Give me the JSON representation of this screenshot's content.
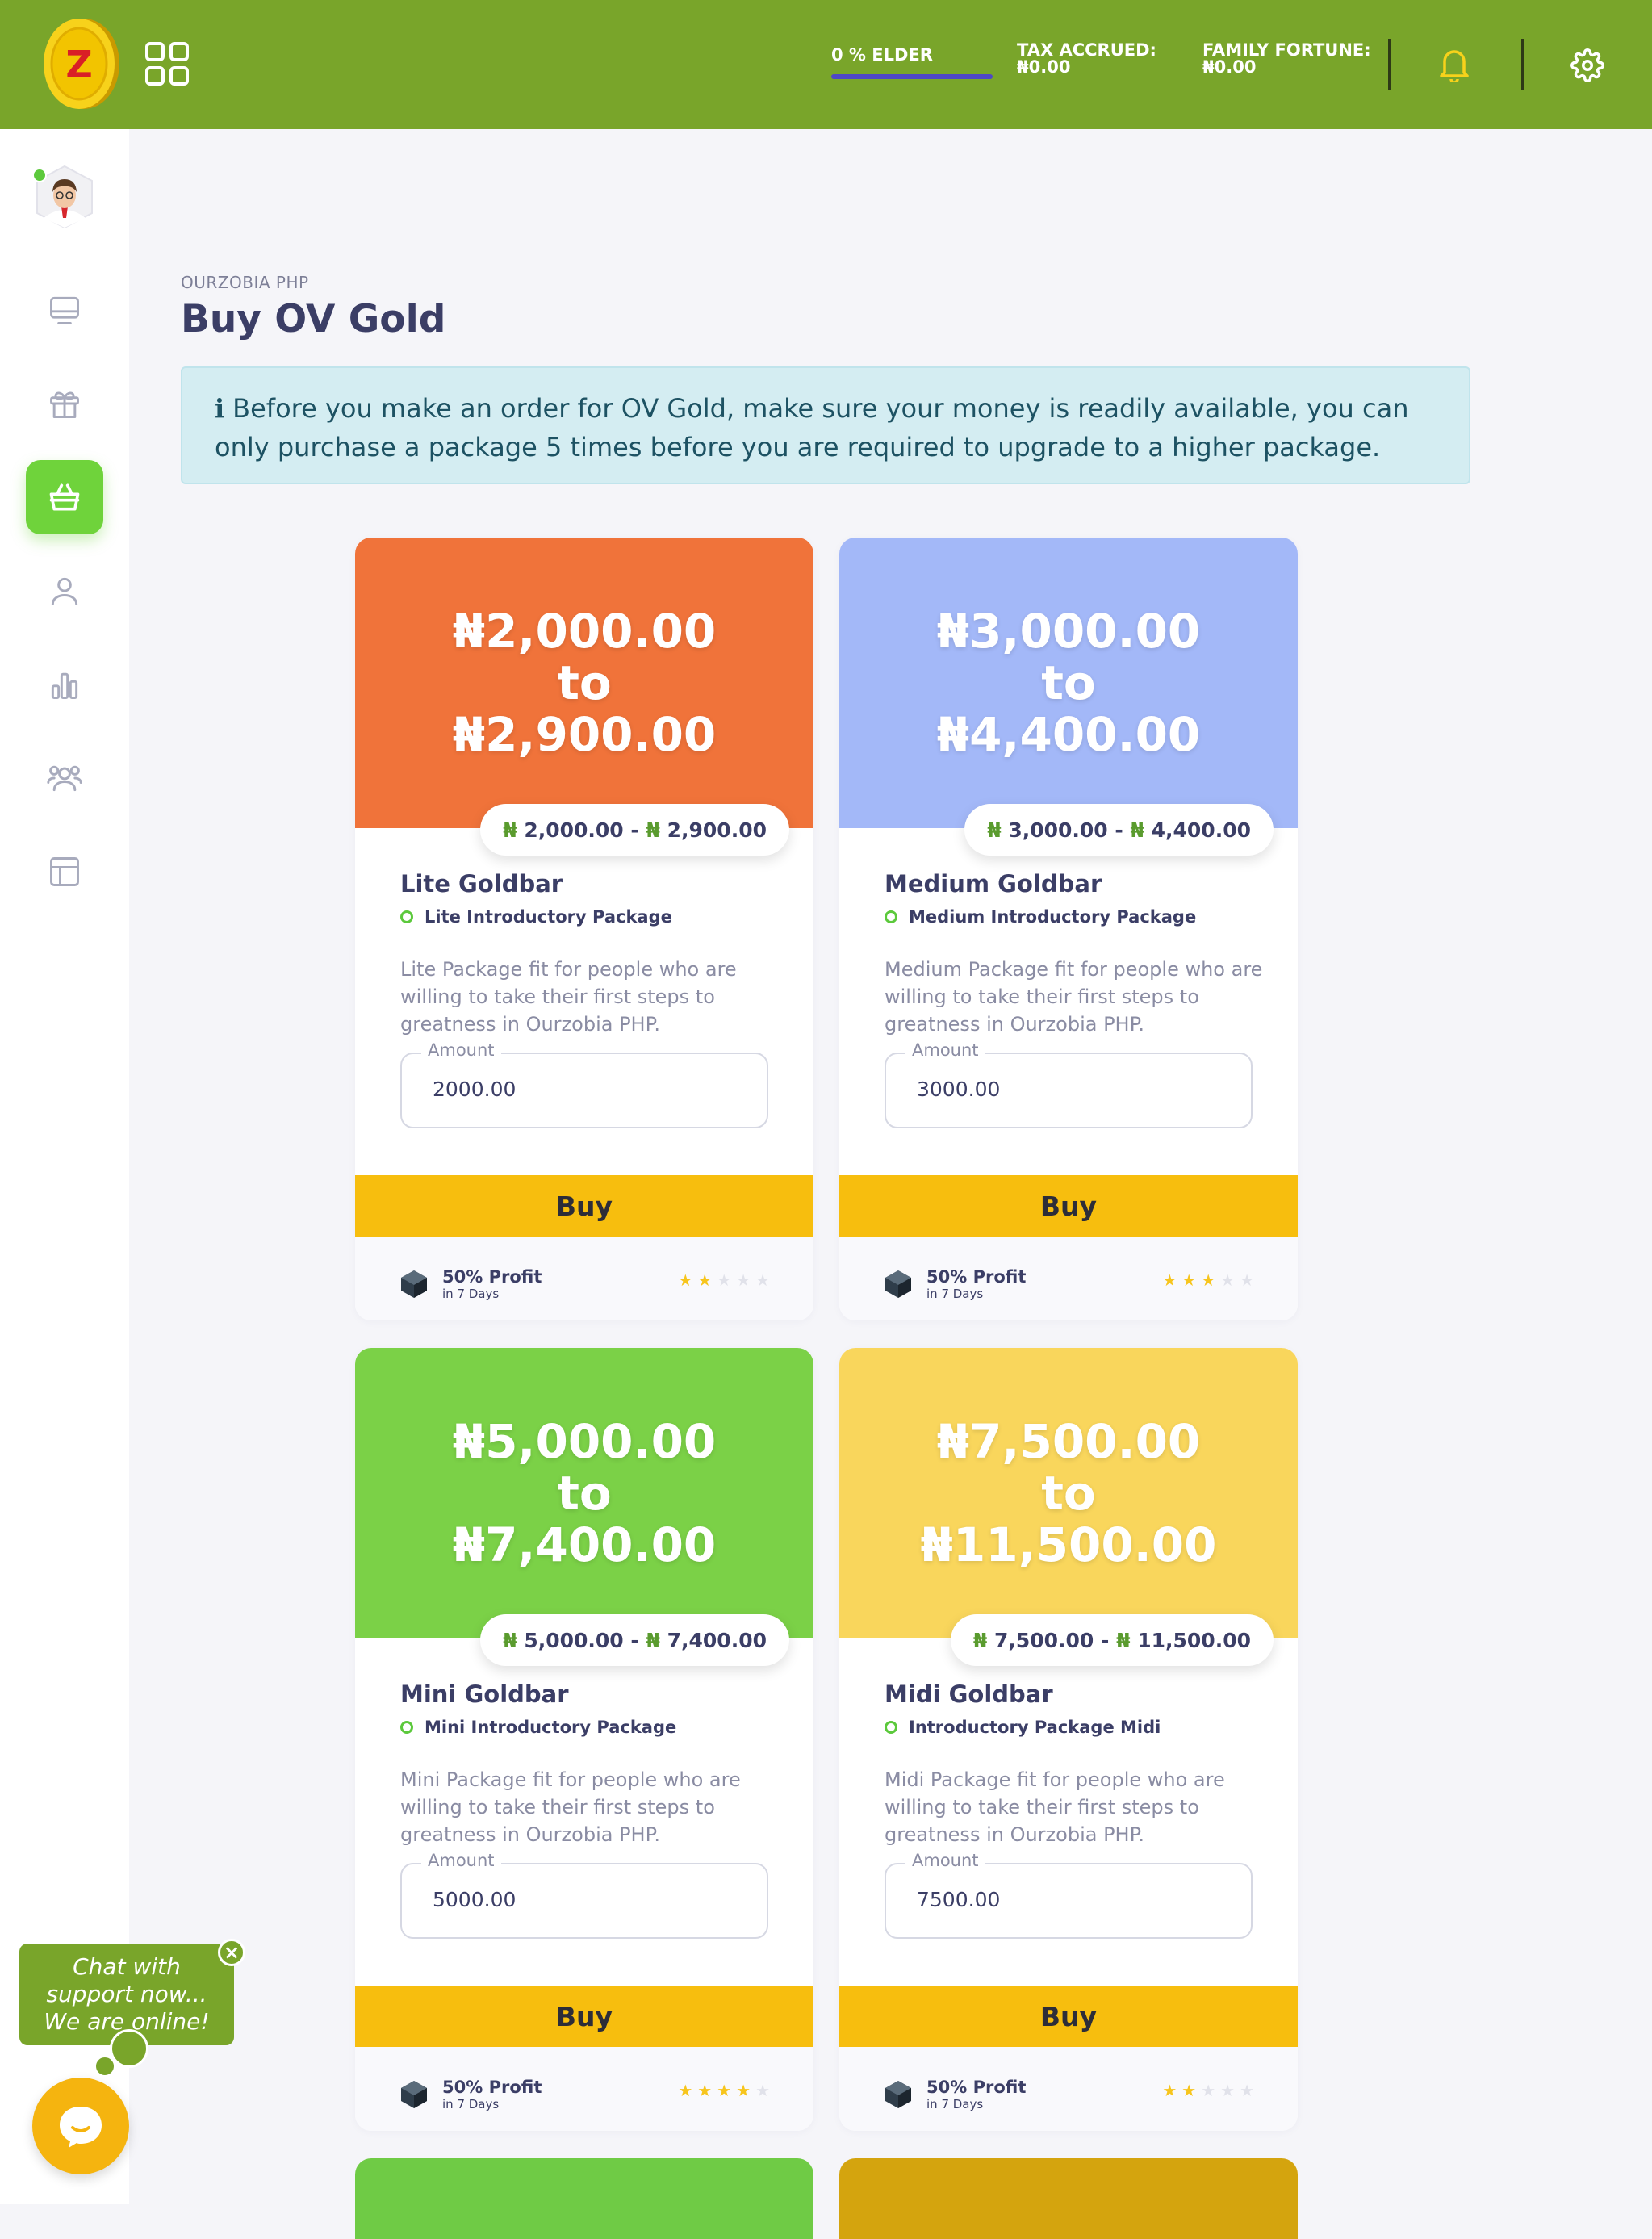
{
  "topbar": {
    "elder_label": "0 % ELDER",
    "tax_label": "TAX ACCRUED:",
    "tax_value": "₦0.00",
    "fortune_label": "FAMILY FORTUNE:",
    "fortune_value": "₦0.00",
    "accent": "#79a52a"
  },
  "sidebar": {
    "items": [
      {
        "icon": "monitor-icon"
      },
      {
        "icon": "gift-icon"
      },
      {
        "icon": "basket-icon",
        "active": true
      },
      {
        "icon": "user-icon"
      },
      {
        "icon": "bar-chart-icon"
      },
      {
        "icon": "users-icon"
      },
      {
        "icon": "layout-icon"
      }
    ]
  },
  "page": {
    "breadcrumb": "OURZOBIA PHP",
    "title": "Buy OV Gold",
    "alert": "Before you make an order for OV Gold, make sure your money is readily available, you can only purchase a package 5 times before you are required to upgrade to a higher package."
  },
  "amount_label": "Amount",
  "buy_label": "Buy",
  "profit_label": "50% Profit",
  "profit_days": "in 7 Days",
  "cards": [
    {
      "color": "#f0733a",
      "head_min": "₦2,000.00",
      "head_to": "to",
      "head_max": "₦2,900.00",
      "pill_min": "2,000.00",
      "pill_max": "2,900.00",
      "name": "Lite Goldbar",
      "subtitle": "Lite Introductory Package",
      "description": "Lite Package fit for people who are willing to take their first steps to greatness in Ourzobia PHP.",
      "amount": "2000.00",
      "rating": 2
    },
    {
      "color": "#a3b8f8",
      "head_min": "₦3,000.00",
      "head_to": "to",
      "head_max": "₦4,400.00",
      "pill_min": "3,000.00",
      "pill_max": "4,400.00",
      "name": "Medium Goldbar",
      "subtitle": "Medium Introductory Package",
      "description": "Medium Package fit for people who are willing to take their first steps to greatness in Ourzobia PHP.",
      "amount": "3000.00",
      "rating": 3
    },
    {
      "color": "#7bd147",
      "head_min": "₦5,000.00",
      "head_to": "to",
      "head_max": "₦7,400.00",
      "pill_min": "5,000.00",
      "pill_max": "7,400.00",
      "name": "Mini Goldbar",
      "subtitle": "Mini Introductory Package",
      "description": "Mini Package fit for people who are willing to take their first steps to greatness in Ourzobia PHP.",
      "amount": "5000.00",
      "rating": 4
    },
    {
      "color": "#f9d65c",
      "head_min": "₦7,500.00",
      "head_to": "to",
      "head_max": "₦11,500.00",
      "pill_min": "7,500.00",
      "pill_max": "11,500.00",
      "name": "Midi Goldbar",
      "subtitle": "Introductory Package Midi",
      "description": "Midi Package fit for people who are willing to take their first steps to greatness in Ourzobia PHP.",
      "amount": "7500.00",
      "rating": 2
    }
  ],
  "next_cards": [
    {
      "color": "#6fcb45"
    },
    {
      "color": "#d4a40e"
    }
  ],
  "chat": {
    "line1": "Chat with",
    "line2": "support now...",
    "line3": "We are online!",
    "close": "×"
  }
}
